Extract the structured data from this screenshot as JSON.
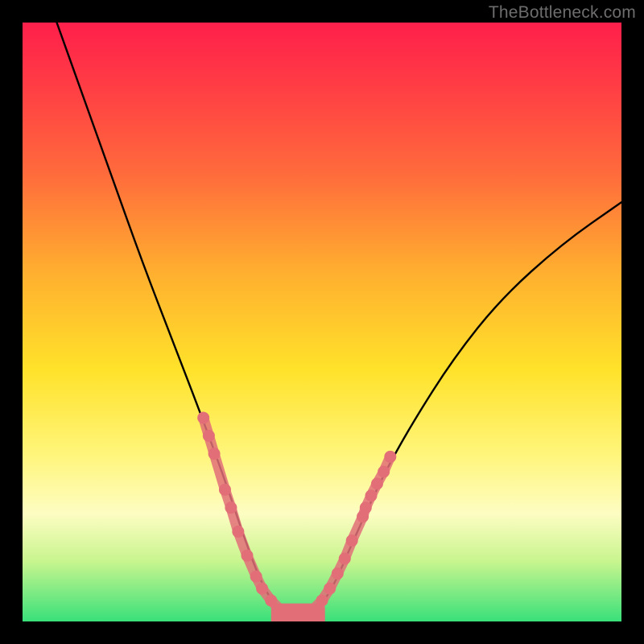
{
  "watermark": "TheBottleneck.com",
  "chart_data": {
    "type": "line",
    "title": "",
    "xlabel": "",
    "ylabel": "",
    "xlim": [
      0,
      100
    ],
    "ylim": [
      0,
      100
    ],
    "background_gradient": [
      "#ff1f4b",
      "#ff6a3c",
      "#ffe22a",
      "#fdfdc2",
      "#39e07a"
    ],
    "curve": {
      "description": "V-shaped bottleneck curve; minimum near x≈45",
      "points_normalized_0_100": [
        {
          "x": 5,
          "y": 102
        },
        {
          "x": 10,
          "y": 88
        },
        {
          "x": 15,
          "y": 74
        },
        {
          "x": 20,
          "y": 60
        },
        {
          "x": 25,
          "y": 47
        },
        {
          "x": 30,
          "y": 34
        },
        {
          "x": 34,
          "y": 23
        },
        {
          "x": 37,
          "y": 14
        },
        {
          "x": 40,
          "y": 6
        },
        {
          "x": 43,
          "y": 1.5
        },
        {
          "x": 46,
          "y": 0.8
        },
        {
          "x": 49,
          "y": 1.5
        },
        {
          "x": 52,
          "y": 6
        },
        {
          "x": 55,
          "y": 13
        },
        {
          "x": 60,
          "y": 24
        },
        {
          "x": 65,
          "y": 33
        },
        {
          "x": 72,
          "y": 44
        },
        {
          "x": 80,
          "y": 54
        },
        {
          "x": 90,
          "y": 63
        },
        {
          "x": 100,
          "y": 70
        }
      ]
    },
    "markers_left": [
      {
        "x": 30.2,
        "y": 34
      },
      {
        "x": 31.1,
        "y": 31
      },
      {
        "x": 32.0,
        "y": 28
      },
      {
        "x": 33.8,
        "y": 22
      },
      {
        "x": 34.8,
        "y": 19
      },
      {
        "x": 36.0,
        "y": 15
      },
      {
        "x": 37.5,
        "y": 11
      },
      {
        "x": 39.0,
        "y": 7.5
      },
      {
        "x": 40.0,
        "y": 5.5
      },
      {
        "x": 41.5,
        "y": 3.5
      },
      {
        "x": 43.0,
        "y": 2.0
      }
    ],
    "markers_right": [
      {
        "x": 48.5,
        "y": 2.0
      },
      {
        "x": 50.0,
        "y": 3.5
      },
      {
        "x": 51.3,
        "y": 5.5
      },
      {
        "x": 52.6,
        "y": 8.0
      },
      {
        "x": 53.8,
        "y": 10.5
      },
      {
        "x": 55.0,
        "y": 13.5
      },
      {
        "x": 56.8,
        "y": 17.5
      },
      {
        "x": 57.3,
        "y": 19.0
      },
      {
        "x": 58.2,
        "y": 21.0
      },
      {
        "x": 59.2,
        "y": 23.0
      },
      {
        "x": 60.3,
        "y": 25.0
      },
      {
        "x": 61.4,
        "y": 27.5
      }
    ],
    "bottom_bar": {
      "x_start": 41.5,
      "x_end": 50.5,
      "y": 0.8,
      "height": 2.2
    },
    "marker_color": "#e26e78",
    "curve_color": "#000000"
  }
}
